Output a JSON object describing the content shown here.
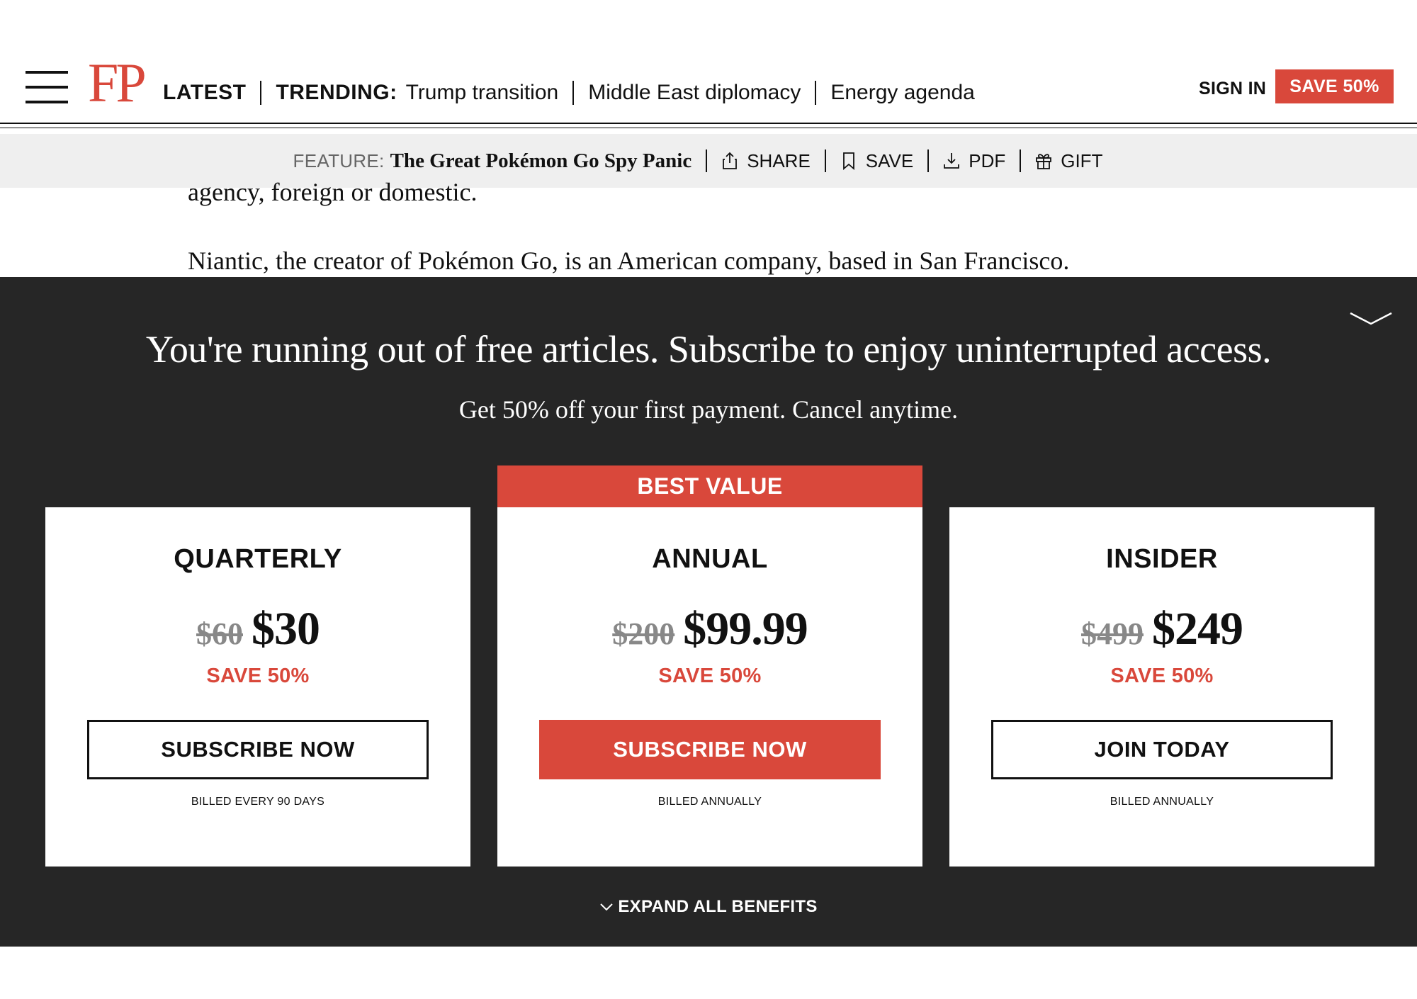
{
  "header": {
    "logo": "FP",
    "latest": "LATEST",
    "trending_label": "TRENDING:",
    "trending": [
      "Trump transition",
      "Middle East diplomacy",
      "Energy agenda"
    ],
    "sign_in": "SIGN IN",
    "save_cta": "SAVE 50%"
  },
  "feature_bar": {
    "label": "FEATURE:",
    "title": "The Great Pokémon Go Spy Panic",
    "tools": {
      "share": "SHARE",
      "save": "SAVE",
      "pdf": "PDF",
      "gift": "GIFT"
    }
  },
  "article": {
    "line1": "agency, foreign or domestic.",
    "line2": "Niantic, the creator of Pokémon Go, is an American company, based in San Francisco."
  },
  "paywall": {
    "headline": "You're running out of free articles. Subscribe to enjoy uninterrupted access.",
    "subheadline": "Get 50% off your first payment. Cancel anytime.",
    "best_value_badge": "BEST VALUE",
    "plans": [
      {
        "name": "QUARTERLY",
        "old_price": "$60",
        "price": "$30",
        "save": "SAVE 50%",
        "cta": "SUBSCRIBE NOW",
        "billing": "BILLED EVERY 90 DAYS"
      },
      {
        "name": "ANNUAL",
        "old_price": "$200",
        "price": "$99.99",
        "save": "SAVE 50%",
        "cta": "SUBSCRIBE NOW",
        "billing": "BILLED ANNUALLY"
      },
      {
        "name": "INSIDER",
        "old_price": "$499",
        "price": "$249",
        "save": "SAVE 50%",
        "cta": "JOIN TODAY",
        "billing": "BILLED ANNUALLY"
      }
    ],
    "expand_label": "EXPAND ALL BENEFITS"
  },
  "colors": {
    "accent": "#d9483b",
    "overlay": "#262626",
    "toolbar": "#efefef"
  },
  "icons": [
    "menu-icon",
    "share-icon",
    "bookmark-icon",
    "download-icon",
    "gift-icon",
    "chevron-down-icon"
  ]
}
